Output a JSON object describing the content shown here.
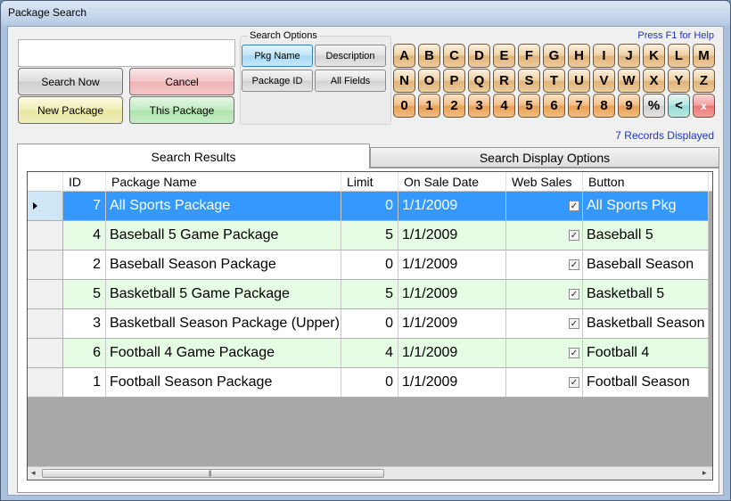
{
  "window": {
    "title": "Package Search"
  },
  "help_text": "Press F1 for Help",
  "records_text": "7 Records Displayed",
  "search": {
    "value": "",
    "placeholder": ""
  },
  "buttons": {
    "search_now": "Search Now",
    "cancel": "Cancel",
    "new_package": "New Package",
    "this_package": "This Package"
  },
  "search_options": {
    "title": "Search Options",
    "options": [
      {
        "label": "Pkg Name",
        "active": true
      },
      {
        "label": "Description",
        "active": false
      },
      {
        "label": "Package ID",
        "active": false
      },
      {
        "label": "All Fields",
        "active": false
      }
    ]
  },
  "keys": {
    "row1": [
      "A",
      "B",
      "C",
      "D",
      "E",
      "F",
      "G",
      "H",
      "I",
      "J",
      "K",
      "L",
      "M"
    ],
    "row2": [
      "N",
      "O",
      "P",
      "Q",
      "R",
      "S",
      "T",
      "U",
      "V",
      "W",
      "X",
      "Y",
      "Z"
    ],
    "row3": [
      "0",
      "1",
      "2",
      "3",
      "4",
      "5",
      "6",
      "7",
      "8",
      "9",
      "%",
      "<",
      "x"
    ]
  },
  "tabs": [
    "Search Results",
    "Search Display Options"
  ],
  "grid": {
    "columns": [
      "ID",
      "Package Name",
      "Limit",
      "On Sale Date",
      "Web Sales",
      "Button"
    ],
    "rows": [
      {
        "id": "7",
        "name": "All Sports Package",
        "limit": "0",
        "date": "1/1/2009",
        "web": "✓",
        "button": "All Sports Pkg"
      },
      {
        "id": "4",
        "name": "Baseball 5 Game Package",
        "limit": "5",
        "date": "1/1/2009",
        "web": "✓",
        "button": "Baseball 5"
      },
      {
        "id": "2",
        "name": "Baseball Season Package",
        "limit": "0",
        "date": "1/1/2009",
        "web": "✓",
        "button": "Baseball Season"
      },
      {
        "id": "5",
        "name": "Basketball 5 Game Package",
        "limit": "5",
        "date": "1/1/2009",
        "web": "✓",
        "button": "Basketball 5"
      },
      {
        "id": "3",
        "name": "Basketball Season Package (Upper)",
        "limit": "0",
        "date": "1/1/2009",
        "web": "✓",
        "button": "Basketball Season"
      },
      {
        "id": "6",
        "name": "Football 4 Game Package",
        "limit": "4",
        "date": "1/1/2009",
        "web": "✓",
        "button": "Football 4"
      },
      {
        "id": "1",
        "name": "Football Season Package",
        "limit": "0",
        "date": "1/1/2009",
        "web": "✓",
        "button": "Football Season"
      }
    ],
    "selected_row": 0
  },
  "colors": {
    "selected_row": "#3399ff",
    "alt_row": "#e6fbe3",
    "link_blue": "#1f33c7"
  }
}
